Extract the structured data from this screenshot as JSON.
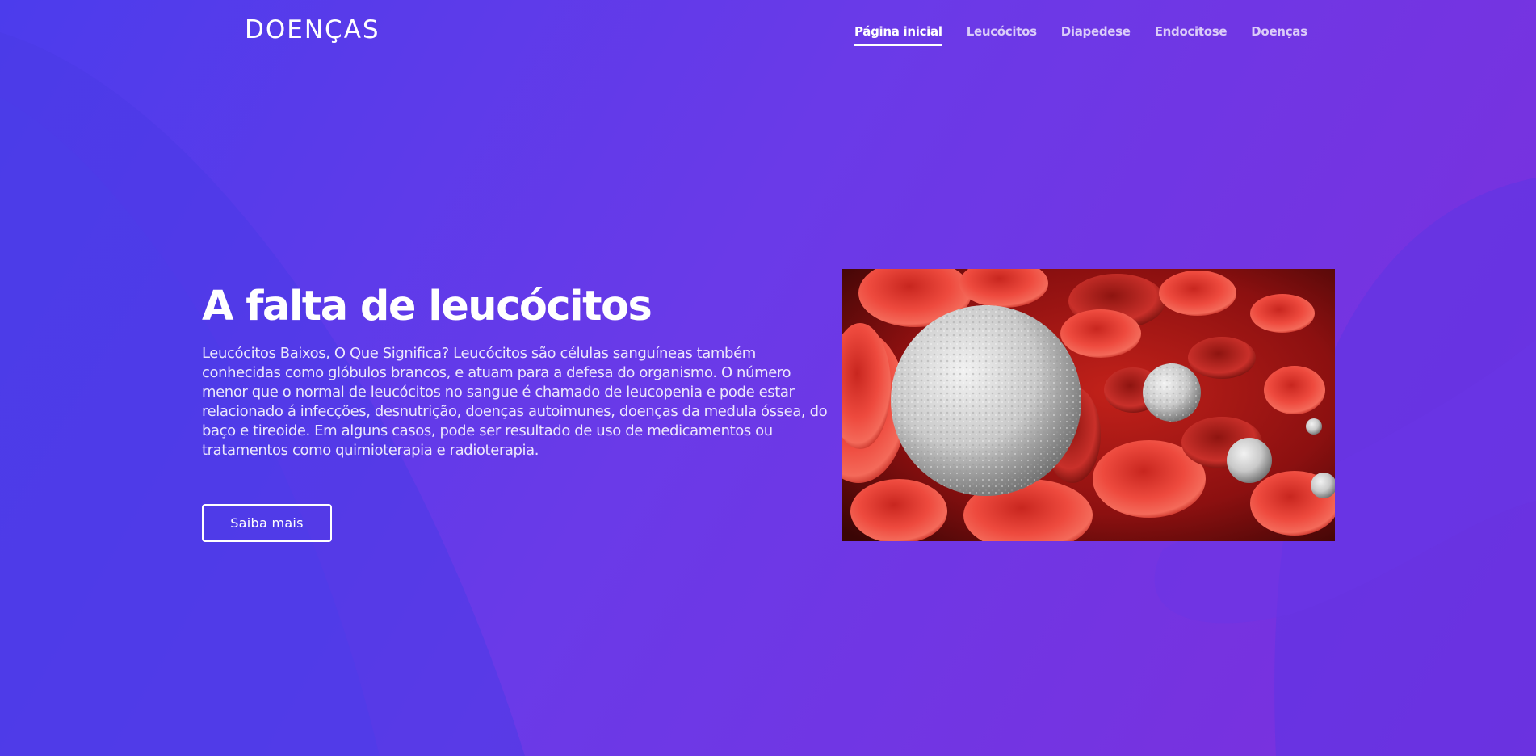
{
  "header": {
    "brand": "DOENÇAS",
    "nav": [
      {
        "label": "Página inicial",
        "active": true
      },
      {
        "label": "Leucócitos",
        "active": false
      },
      {
        "label": "Diapedese",
        "active": false
      },
      {
        "label": "Endocitose",
        "active": false
      },
      {
        "label": "Doenças",
        "active": false
      }
    ]
  },
  "hero": {
    "title": "A falta de leucócitos",
    "text": "Leucócitos Baixos, O Que Significa? Leucócitos são células sanguíneas também conhecidas como glóbulos brancos, e atuam para a defesa do organismo. O número menor que o normal de leucócitos no sangue é chamado de leucopenia e pode estar relacionado á infecções, desnutrição, doenças autoimunes, doenças da medula óssea, do baço e tireoide. Em alguns casos, pode ser resultado de uso de medicamentos ou tratamentos como quimioterapia e radioterapia.",
    "cta_label": "Saiba mais",
    "image_subject": "blood-cells-illustration"
  },
  "colors": {
    "background_start": "#4c3cec",
    "background_end": "#7c2fdc",
    "text": "#ffffff"
  }
}
